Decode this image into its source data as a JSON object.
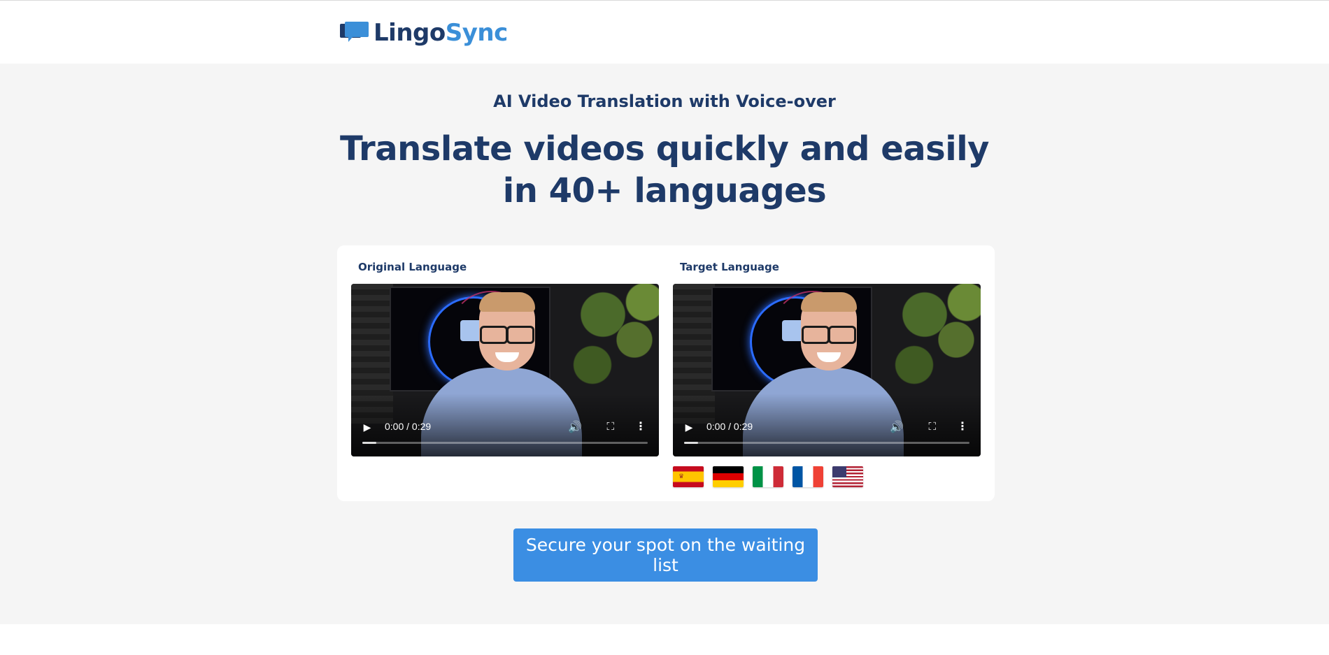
{
  "brand": {
    "name_part1": "Lingo",
    "name_part2": "Sync",
    "icon": "speech-bubble-icon",
    "colors": {
      "dark": "#1e3a68",
      "accent": "#3b8fd8"
    }
  },
  "hero": {
    "subtitle": "AI Video Translation with Voice-over",
    "headline": "Translate videos quickly and easily in 40+ languages"
  },
  "comparison": {
    "original": {
      "label": "Original Language",
      "video": {
        "time": "0:00 / 0:29",
        "progress": 0.05
      }
    },
    "target": {
      "label": "Target Language",
      "video": {
        "time": "0:00 / 0:29",
        "progress": 0.05
      }
    },
    "flags": [
      {
        "name": "spain-flag",
        "icon": "flag-es"
      },
      {
        "name": "germany-flag",
        "icon": "flag-de"
      },
      {
        "name": "italy-flag",
        "icon": "flag-it"
      },
      {
        "name": "france-flag",
        "icon": "flag-fr"
      },
      {
        "name": "usa-flag",
        "icon": "flag-us"
      }
    ]
  },
  "cta": {
    "label": "Secure your spot on the waiting list",
    "color": "#3b8ee3"
  }
}
